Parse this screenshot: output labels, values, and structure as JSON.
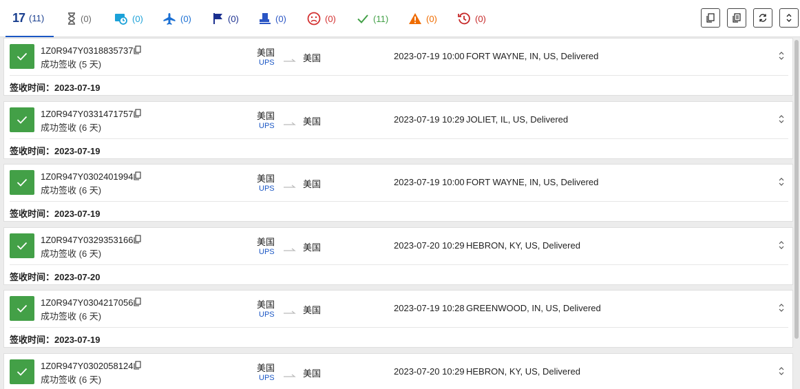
{
  "header": {
    "logo_text": "17",
    "tabs": [
      {
        "name": "tab-all",
        "count": "(11)",
        "icon": "logo-17-icon",
        "color": "#1a3f8f"
      },
      {
        "name": "tab-not-found",
        "count": "(0)",
        "icon": "hourglass-icon",
        "color": "#666666"
      },
      {
        "name": "tab-in-transit-pickup",
        "count": "(0)",
        "icon": "truck-clock-icon",
        "color": "#1ba1d8"
      },
      {
        "name": "tab-in-transit",
        "count": "(0)",
        "icon": "plane-icon",
        "color": "#1a6fd3"
      },
      {
        "name": "tab-pick-up",
        "count": "(0)",
        "icon": "flag-icon",
        "color": "#1a2f8f"
      },
      {
        "name": "tab-out-for-delivery",
        "count": "(0)",
        "icon": "courier-icon",
        "color": "#2a55c4"
      },
      {
        "name": "tab-undelivered",
        "count": "(0)",
        "icon": "sad-face-icon",
        "color": "#d32f2f"
      },
      {
        "name": "tab-delivered",
        "count": "(11)",
        "icon": "check-icon",
        "color": "#43a047"
      },
      {
        "name": "tab-alert",
        "count": "(0)",
        "icon": "warning-icon",
        "color": "#ef6c00"
      },
      {
        "name": "tab-expired",
        "count": "(0)",
        "icon": "history-icon",
        "color": "#c62828"
      }
    ],
    "toolbar": [
      "copy-icon",
      "copy-all-icon",
      "refresh-icon",
      "expand-collapse-icon"
    ]
  },
  "shipments": [
    {
      "number": "1Z0R947Y0318835737",
      "status": "成功签收 (5 天)",
      "origin": "美国",
      "carrier": "UPS",
      "destination": "美国",
      "event_time": "2023-07-19 10:00",
      "event": "FORT WAYNE, IN, US, Delivered",
      "signed": "签收时间：2023-07-19"
    },
    {
      "number": "1Z0R947Y0331471757",
      "status": "成功签收 (6 天)",
      "origin": "美国",
      "carrier": "UPS",
      "destination": "美国",
      "event_time": "2023-07-19 10:29",
      "event": "JOLIET, IL, US, Delivered",
      "signed": "签收时间：2023-07-19"
    },
    {
      "number": "1Z0R947Y0302401994",
      "status": "成功签收 (6 天)",
      "origin": "美国",
      "carrier": "UPS",
      "destination": "美国",
      "event_time": "2023-07-19 10:00",
      "event": "FORT WAYNE, IN, US, Delivered",
      "signed": "签收时间：2023-07-19"
    },
    {
      "number": "1Z0R947Y0329353166",
      "status": "成功签收 (6 天)",
      "origin": "美国",
      "carrier": "UPS",
      "destination": "美国",
      "event_time": "2023-07-20 10:29",
      "event": "HEBRON, KY, US, Delivered",
      "signed": "签收时间：2023-07-20"
    },
    {
      "number": "1Z0R947Y0304217056",
      "status": "成功签收 (6 天)",
      "origin": "美国",
      "carrier": "UPS",
      "destination": "美国",
      "event_time": "2023-07-19 10:28",
      "event": "GREENWOOD, IN, US, Delivered",
      "signed": "签收时间：2023-07-19"
    },
    {
      "number": "1Z0R947Y0302058124",
      "status": "成功签收 (6 天)",
      "origin": "美国",
      "carrier": "UPS",
      "destination": "美国",
      "event_time": "2023-07-20 10:29",
      "event": "HEBRON, KY, US, Delivered",
      "signed": ""
    }
  ]
}
